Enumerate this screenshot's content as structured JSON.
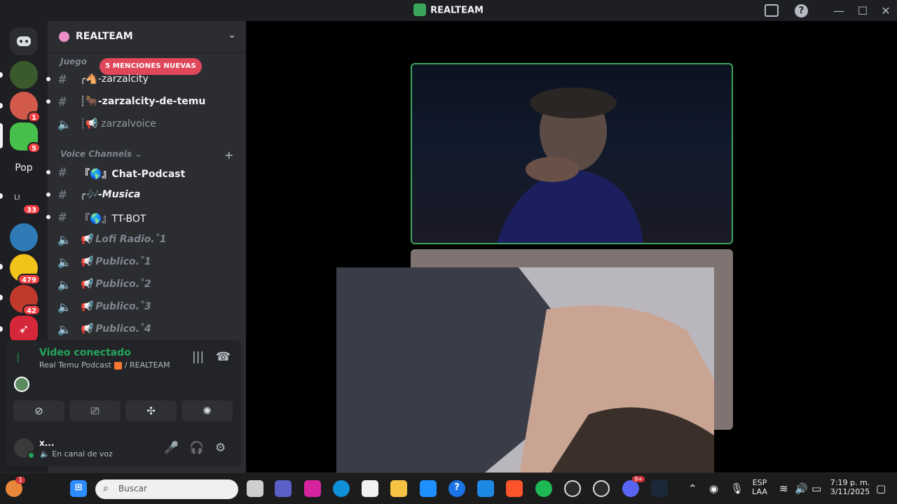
{
  "window": {
    "title": "REALTEAM"
  },
  "servers": [
    {
      "name": "server-1",
      "color": "#3a5a2e",
      "badge": ""
    },
    {
      "name": "server-2",
      "color": "#d15a4a",
      "badge": "1"
    },
    {
      "name": "server-3",
      "color": "#46c04a",
      "badge": "5"
    },
    {
      "name": "server-pop",
      "label": "Pop",
      "color": "#1e1f22",
      "badge": ""
    },
    {
      "name": "server-li",
      "label": "LI",
      "color": "#1e1f22",
      "badge": "33"
    },
    {
      "name": "server-6",
      "color": "#2f7bb5",
      "badge": ""
    },
    {
      "name": "server-7",
      "color": "#f0c419",
      "badge": "479"
    },
    {
      "name": "server-8",
      "color": "#c0392b",
      "badge": "42"
    },
    {
      "name": "server-9",
      "color": "#d6263a",
      "badge": ""
    }
  ],
  "guild": {
    "name": "REALTEAM",
    "mentions_pill": "5 MENCIONES NUEVAS",
    "category_games": "Juego",
    "category_voice": "Voice Channels",
    "channels": [
      {
        "type": "text",
        "label": "╭🐴-zarzalcity",
        "style": "bold",
        "unread": true
      },
      {
        "type": "text",
        "label": "┊🐂-zarzalcity-de-temu",
        "style": "bold",
        "unread": true
      },
      {
        "type": "voice",
        "label": "┊📢 zarzalvoice",
        "style": "normal",
        "unread": false
      },
      {
        "type": "text",
        "label": "『🌎』Chat-Podcast",
        "style": "bold",
        "unread": true
      },
      {
        "type": "text",
        "label": "╭🎶-Musica",
        "style": "bolditalic",
        "unread": true
      },
      {
        "type": "text",
        "label": "『🌎』TT-BOT",
        "style": "normal",
        "unread": true
      },
      {
        "type": "voice",
        "label": "📢 Lofi Radio.˚1",
        "style": "italic",
        "unread": false
      },
      {
        "type": "voice",
        "label": "📢 Publico.˚1",
        "style": "italic",
        "unread": false
      },
      {
        "type": "voice",
        "label": "📢 Publico.˚2",
        "style": "italic",
        "unread": false
      },
      {
        "type": "voice",
        "label": "📢 Publico.˚3",
        "style": "italic",
        "unread": false
      },
      {
        "type": "voice",
        "label": "📢 Publico.˚4",
        "style": "italic",
        "unread": false
      }
    ]
  },
  "voice": {
    "status": "Video conectado",
    "channel": "Real Temu Podcast",
    "server": "/ REALTEAM"
  },
  "user": {
    "name": "x...",
    "status": "🔈 En canal de voz"
  },
  "taskbar": {
    "search_placeholder": "Buscar",
    "lang_top": "ESP",
    "lang_bottom": "LAA",
    "time": "7:19 p. m.",
    "date": "3/11/2025",
    "notif_badge": "1",
    "discord_badge": "9+"
  },
  "colors": {
    "accent_green": "#23a55a",
    "mention_red": "#e0475a",
    "badge_red": "#f23f43"
  }
}
